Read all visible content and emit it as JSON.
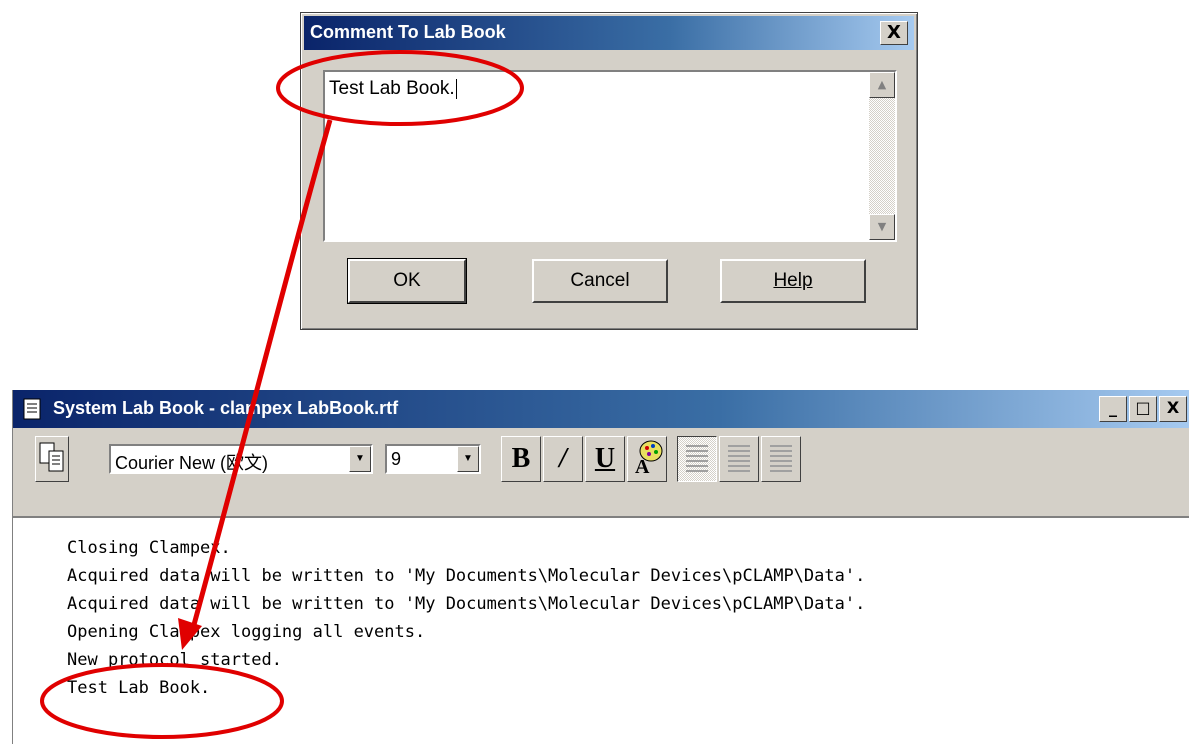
{
  "dialog": {
    "title": "Comment To Lab Book",
    "close_label": "X",
    "comment_value": "Test Lab Book.",
    "ok_label": "OK",
    "cancel_label": "Cancel",
    "help_label": "Help"
  },
  "labbook": {
    "title": "System Lab Book - clampex LabBook.rtf",
    "window_buttons": [
      "_",
      "□",
      "X"
    ],
    "font_name": "Courier New (欧文)",
    "font_size": "9",
    "bold_label": "B",
    "italic_label": "/",
    "underline_label": "U",
    "lines": [
      "Closing Clampex.",
      "Acquired data will be written to 'My Documents\\Molecular Devices\\pCLAMP\\Data'.",
      "Acquired data will be written to 'My Documents\\Molecular Devices\\pCLAMP\\Data'.",
      "Opening Clampex logging all events.",
      "New protocol started.",
      "Test Lab Book."
    ]
  },
  "colors": {
    "annotation": "#e00000",
    "titlebar": "#0a246a"
  }
}
